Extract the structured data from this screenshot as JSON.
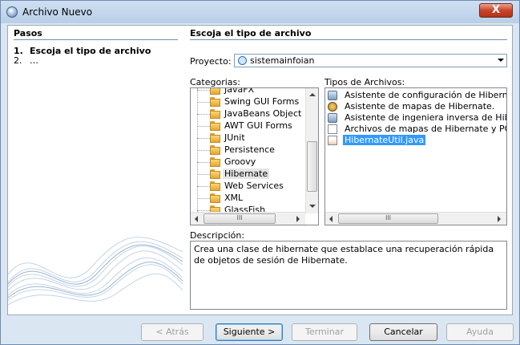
{
  "window": {
    "title": "Archivo Nuevo",
    "close_label": "X"
  },
  "steps": {
    "heading": "Pasos",
    "items": [
      {
        "num": "1.",
        "label": "Escoja el tipo de archivo"
      },
      {
        "num": "2.",
        "label": "…"
      }
    ]
  },
  "main": {
    "heading": "Escoja el tipo de archivo",
    "project_label": "Proyecto:",
    "project_value": "sistemainfoian",
    "categories_label": "Categorias:",
    "categories": [
      "JavaFX",
      "Swing GUI Forms",
      "JavaBeans Object",
      "AWT GUI Forms",
      "JUnit",
      "Persistence",
      "Groovy",
      "Hibernate",
      "Web Services",
      "XML",
      "GlassFish"
    ],
    "file_types_label": "Tipos de Archivos:",
    "file_types": [
      "Asistente de configuración de Hibernate",
      "Asistente de mapas de Hibernate.",
      "Asistente de ingeniera inversa de Hibernat",
      "Archivos de mapas de Hibernate y POJOs",
      "HibernateUtil.java"
    ],
    "selected_file_type": "HibernateUtil.java",
    "scroll_thumb_label": "III",
    "description_label": "Descripción:",
    "description": "Crea una clase de hibernate que establace una recuperación rápida de objetos de sesión de Hibernate."
  },
  "buttons": {
    "back": "< Atrás",
    "next": "Siguiente >",
    "finish": "Terminar",
    "cancel": "Cancelar",
    "help": "Ayuda"
  },
  "colors": {
    "selection": "#3399ff",
    "titlebar": "#c3d6ec",
    "close": "#c8452b"
  }
}
